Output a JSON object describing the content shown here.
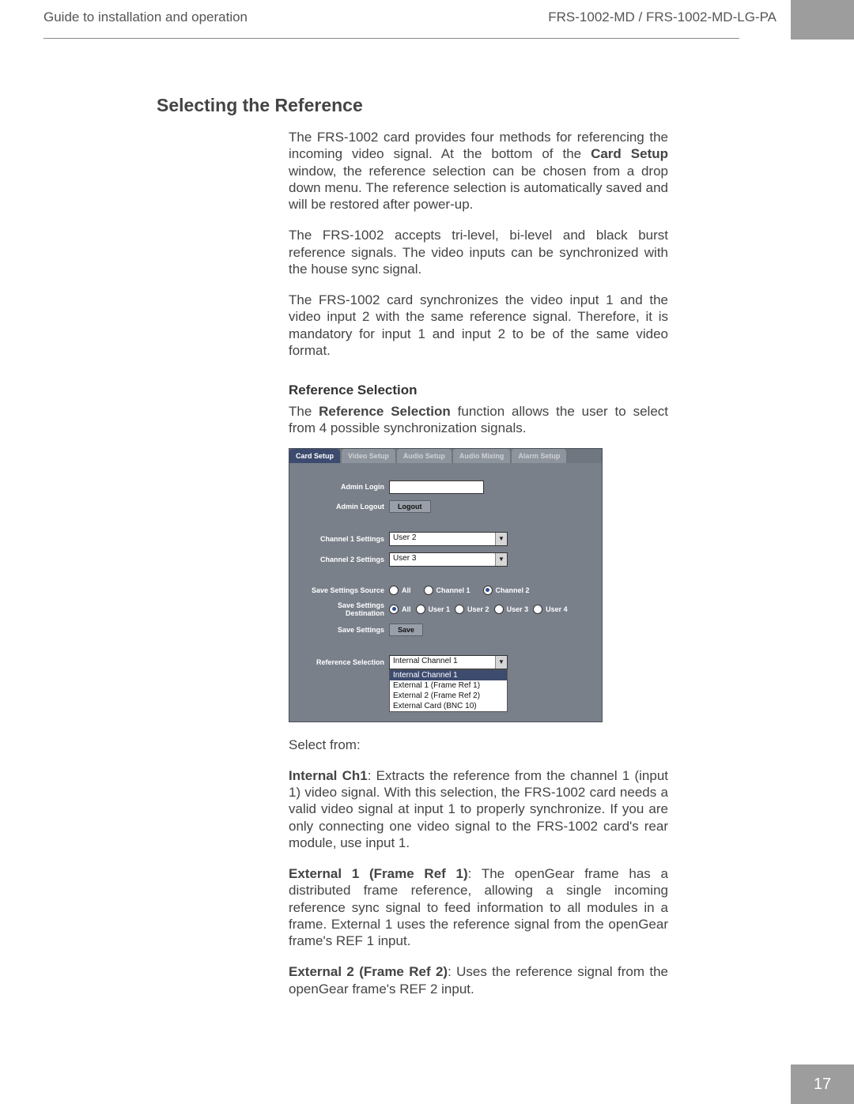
{
  "header": {
    "left": "Guide to installation and operation",
    "right": "FRS-1002-MD / FRS-1002-MD-LG-PA"
  },
  "section": {
    "title": "Selecting the Reference",
    "paragraphs": {
      "p1a": "The FRS-1002 card provides four methods for referencing the incoming video signal. At the bottom of the ",
      "p1b": "Card Setup",
      "p1c": " window, the reference selection can be chosen from a drop down menu. The reference selection is automatically saved and will be restored after power-up.",
      "p2": "The FRS-1002 accepts tri-level, bi-level and black burst reference signals. The video inputs can be synchronized with the house sync signal.",
      "p3": "The FRS-1002 card synchronizes the video input 1 and the video input 2 with the same reference signal. Therefore, it is mandatory for input 1 and input 2 to be of the same video format."
    },
    "subheading": "Reference Selection",
    "subpara_a": "The ",
    "subpara_b": "Reference Selection",
    "subpara_c": " function allows the user to select from 4 possible synchronization signals.",
    "select_from": "Select from:",
    "opt1_bold": "Internal Ch1",
    "opt1_text": ": Extracts the reference from the channel 1 (input 1) video signal. With this selection, the FRS-1002 card needs a valid video signal at input 1 to properly synchronize.  If you are only connecting one video signal to the FRS-1002 card's rear module, use input 1.",
    "opt2_bold": "External 1 (Frame Ref 1)",
    "opt2_text": ": The openGear frame has a distributed frame reference, allowing a single incoming reference sync signal to feed information to all modules in a frame. External 1 uses the reference signal from the openGear frame's REF 1 input.",
    "opt3_bold": "External 2 (Frame Ref 2)",
    "opt3_text": ": Uses the reference signal from the openGear frame's REF 2 input."
  },
  "panel": {
    "tabs": [
      "Card Setup",
      "Video Setup",
      "Audio Setup",
      "Audio Mixing",
      "Alarm Setup"
    ],
    "labels": {
      "admin_login": "Admin Login",
      "admin_logout": "Admin Logout",
      "logout_btn": "Logout",
      "ch1": "Channel 1 Settings",
      "ch2": "Channel 2 Settings",
      "ch1_val": "User 2",
      "ch2_val": "User 3",
      "save_src": "Save Settings Source",
      "save_dst": "Save Settings Destination",
      "save_settings": "Save Settings",
      "save_btn": "Save",
      "ref_sel": "Reference Selection",
      "ref_val": "Internal Channel 1"
    },
    "src_radios": [
      "All",
      "Channel 1",
      "Channel 2"
    ],
    "src_selected": 2,
    "dst_radios": [
      "All",
      "User 1",
      "User 2",
      "User 3",
      "User 4"
    ],
    "dst_selected": 0,
    "ref_options": [
      "Internal Channel 1",
      "External 1 (Frame Ref 1)",
      "External 2 (Frame Ref 2)",
      "External Card (BNC 10)"
    ],
    "ref_selected": 0
  },
  "page_number": "17",
  "icons": {
    "chevron_down": "▼"
  }
}
